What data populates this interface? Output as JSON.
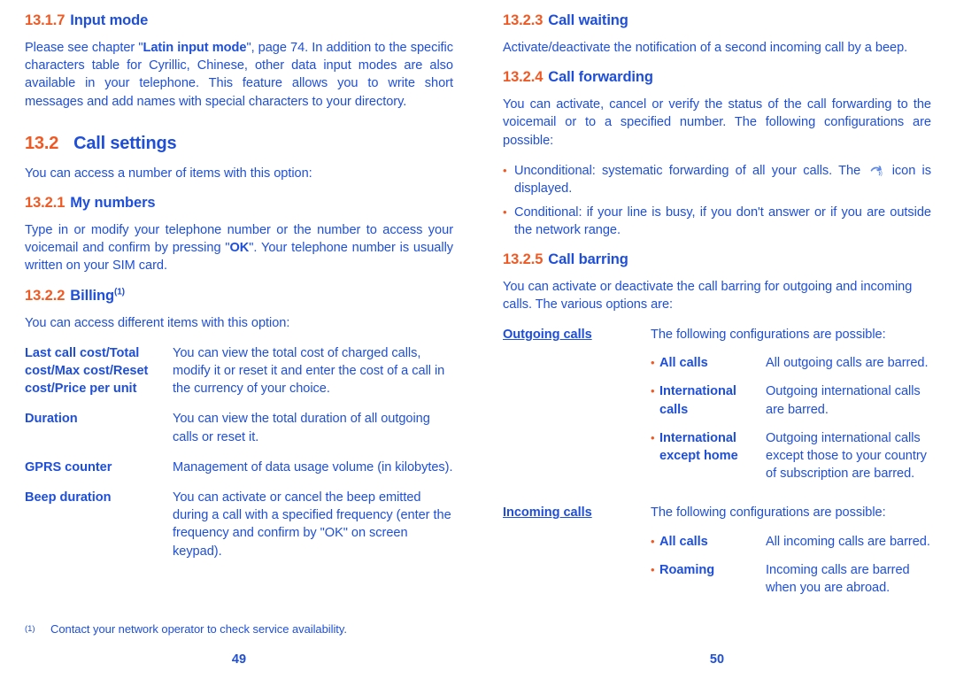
{
  "colors": {
    "heading_blue": "#1f4fd8",
    "number_orange": "#ef5a24",
    "body_blue": "#1f4fd8"
  },
  "left_page": {
    "page_number": "49",
    "section_13_1_7": {
      "number": "13.1.7",
      "title": "Input mode",
      "body_before_bold": "Please see chapter \"",
      "body_bold": "Latin input mode",
      "body_after_bold": "\", page 74. In addition to the specific characters table for Cyrillic, Chinese, other data input modes are also available in your telephone. This feature allows you to write short messages and add names with special characters to your directory."
    },
    "section_13_2": {
      "number": "13.2",
      "title": "Call settings",
      "intro": "You can access a number of items with this option:"
    },
    "section_13_2_1": {
      "number": "13.2.1",
      "title": "My numbers",
      "body_before_bold": "Type in or modify your telephone number or the number to access your voicemail and confirm by pressing \"",
      "body_bold": "OK",
      "body_after_bold": "\". Your telephone number is usually written on your SIM card."
    },
    "section_13_2_2": {
      "number": "13.2.2",
      "title": "Billing",
      "footnote_marker": "(1)",
      "intro": "You can access different items with this option:",
      "rows": [
        {
          "label": "Last call cost/Total cost/Max cost/Reset cost/Price per unit",
          "value": "You can view the total cost of charged calls, modify it or reset it and enter the cost of a call in the currency of your choice."
        },
        {
          "label": "Duration",
          "value": "You can view the total duration of all outgoing calls or reset it."
        },
        {
          "label": "GPRS counter",
          "value": "Management of data usage volume (in kilobytes)."
        },
        {
          "label": "Beep duration",
          "value": "You can activate or cancel the beep emitted during a call with a specified frequency (enter the frequency and confirm by \"OK\" on screen keypad)."
        }
      ]
    },
    "footnote": {
      "marker": "(1)",
      "text": "Contact your network operator to check service availability."
    }
  },
  "right_page": {
    "page_number": "50",
    "section_13_2_3": {
      "number": "13.2.3",
      "title": "Call waiting",
      "body": "Activate/deactivate the notification of a second incoming call by a beep."
    },
    "section_13_2_4": {
      "number": "13.2.4",
      "title": "Call forwarding",
      "body": "You can activate, cancel or verify the status of the call forwarding to the voicemail or to a specified number. The following configurations are possible:",
      "bullets": [
        {
          "text_before_icon": "Unconditional: systematic forwarding of all your calls. The ",
          "icon": "call-forward-icon",
          "text_after_icon": " icon is displayed."
        },
        {
          "text_before_icon": "Conditional: if your line is busy, if you don't answer or if you are outside the network range.",
          "icon": "",
          "text_after_icon": ""
        }
      ]
    },
    "section_13_2_5": {
      "number": "13.2.5",
      "title": "Call barring",
      "body": "You can activate or deactivate the call barring for outgoing and incoming calls. The various options are:",
      "groups": [
        {
          "label": "Outgoing calls",
          "intro": "The following configurations are possible:",
          "options": [
            {
              "name": "All calls",
              "desc": "All outgoing calls are barred."
            },
            {
              "name": "International calls",
              "desc": "Outgoing international calls are barred."
            },
            {
              "name": "International except home",
              "desc": "Outgoing international calls except those to your country of subscription are barred."
            }
          ]
        },
        {
          "label": "Incoming calls",
          "intro": "The following configurations are possible:",
          "options": [
            {
              "name": "All calls",
              "desc": "All incoming calls are barred."
            },
            {
              "name": "Roaming",
              "desc": "Incoming calls are barred when you are abroad."
            }
          ]
        }
      ]
    }
  }
}
